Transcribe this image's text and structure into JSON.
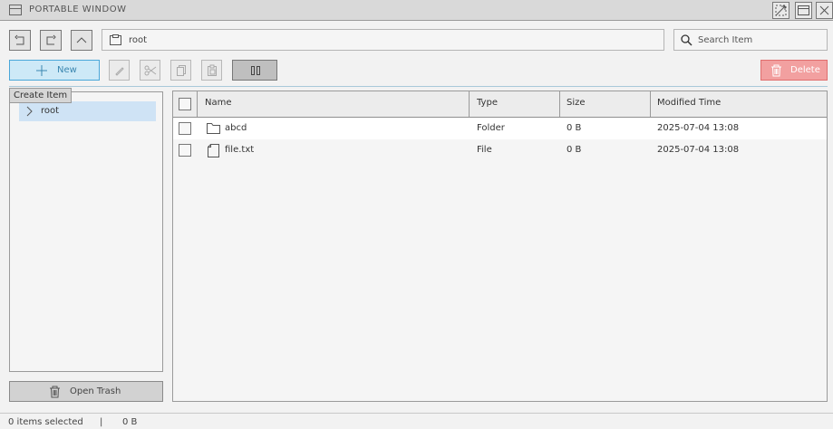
{
  "window": {
    "title": "PORTABLE WINDOW",
    "icons": [
      "window-icon",
      "fullscreen-icon",
      "maximize-icon",
      "close-icon"
    ]
  },
  "nav": {
    "path": "root",
    "search_placeholder": "Search Item"
  },
  "toolbar": {
    "new_label": "New",
    "delete_label": "Delete",
    "tooltip": "Create Item"
  },
  "tree": {
    "items": [
      {
        "label": "root"
      }
    ]
  },
  "sidebar": {
    "trash_label": "Open Trash"
  },
  "table": {
    "columns": [
      "Name",
      "Type",
      "Size",
      "Modified Time"
    ],
    "rows": [
      {
        "name": "abcd",
        "type": "Folder",
        "size": "0 B",
        "modified": "2025-07-04 13:08",
        "icon": "folder-icon"
      },
      {
        "name": "file.txt",
        "type": "File",
        "size": "0 B",
        "modified": "2025-07-04 13:08",
        "icon": "file-icon"
      }
    ]
  },
  "status": {
    "selected": "0 items selected",
    "divider": "|",
    "size": "0 B"
  },
  "colors": {
    "accent": "#4aa7d9",
    "danger": "#f2a0a0",
    "selection": "#cfe3f5"
  }
}
